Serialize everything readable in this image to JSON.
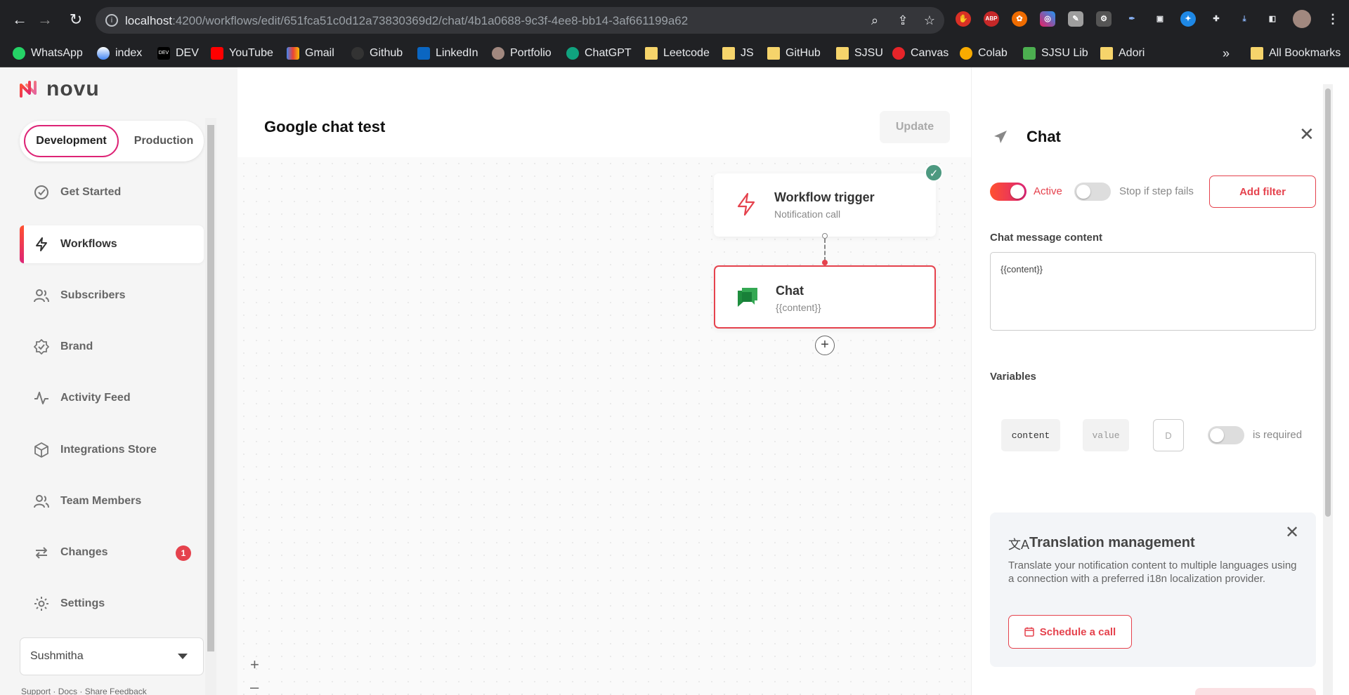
{
  "browser": {
    "url_host": "localhost",
    "url_path": ":4200/workflows/edit/651fca51c0d12a73830369d2/chat/4b1a0688-9c3f-4ee8-bb14-3af661199a62",
    "bookmarks": [
      "WhatsApp",
      "index",
      "DEV",
      "YouTube",
      "Gmail",
      "Github",
      "LinkedIn",
      "Portfolio",
      "ChatGPT",
      "Leetcode",
      "JS",
      "GitHub",
      "SJSU",
      "Canvas",
      "Colab",
      "SJSU Lib",
      "Adori"
    ],
    "more": "»",
    "all_bookmarks": "All Bookmarks",
    "ext_abp": "ABP"
  },
  "app": {
    "logo": "novu",
    "env": {
      "development": "Development",
      "production": "Production"
    },
    "menu": {
      "get_started": "Get Started",
      "workflows": "Workflows",
      "subscribers": "Subscribers",
      "brand": "Brand",
      "activity_feed": "Activity Feed",
      "integrations_store": "Integrations Store",
      "team_members": "Team Members",
      "changes": "Changes",
      "changes_badge": "1",
      "settings": "Settings"
    },
    "org": "Sushmitha",
    "footer": "Support · Docs · Share Feedback"
  },
  "workflow": {
    "title": "Google chat test",
    "update": "Update",
    "trigger": {
      "title": "Workflow trigger",
      "subtitle": "Notification call"
    },
    "chat_node": {
      "title": "Chat",
      "subtitle": "{{content}}"
    },
    "check": "✓",
    "add": "+",
    "zoom_in": "+",
    "zoom_out": "–"
  },
  "panel": {
    "title": "Chat",
    "close": "✕",
    "active_label": "Active",
    "stop_label": "Stop if step fails",
    "add_filter": "Add filter",
    "content_label": "Chat message content",
    "content_value": "{{content}}",
    "variables_label": "Variables",
    "var_name": "content",
    "var_value_placeholder": "value",
    "var_default": "D",
    "required_label": "is required",
    "translation": {
      "icon": "文A",
      "title": "Translation management",
      "description": "Translate your notification content to multiple languages using a connection with a preferred i18n localization provider.",
      "button": "Schedule a call",
      "close": "✕"
    }
  },
  "colors": {
    "accent": "#e5424d",
    "brand_gradient_start": "#ff512f",
    "brand_gradient_end": "#dd2476",
    "success": "#4d9980"
  }
}
